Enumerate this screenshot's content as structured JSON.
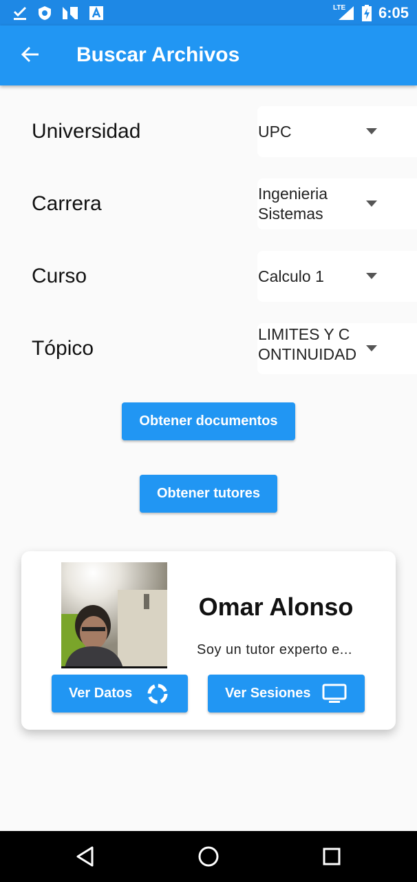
{
  "status_bar": {
    "time": "6:05",
    "network_label": "LTE",
    "icons": [
      "download-done-icon",
      "shield-icon",
      "n-app-icon",
      "a-app-icon",
      "signal-icon",
      "battery-charging-icon"
    ]
  },
  "app_bar": {
    "title": "Buscar Archivos",
    "back_icon": "arrow-back-icon"
  },
  "filters": [
    {
      "label": "Universidad",
      "value": "UPC"
    },
    {
      "label": "Carrera",
      "value": "Ingenieria Sistemas"
    },
    {
      "label": "Curso",
      "value": "Calculo 1"
    },
    {
      "label": "Tópico",
      "value": "LIMITES Y CONTINUIDAD"
    }
  ],
  "actions": {
    "get_documents": "Obtener documentos",
    "get_tutors": "Obtener tutores"
  },
  "tutor_card": {
    "name": "Omar Alonso",
    "description": "Soy un tutor experto e...",
    "view_data_label": "Ver Datos",
    "view_data_icon": "donut-loading-icon",
    "view_sessions_label": "Ver Sesiones",
    "view_sessions_icon": "monitor-icon"
  },
  "nav_bar": {
    "icons": [
      "back-triangle-icon",
      "home-circle-icon",
      "recents-square-icon"
    ]
  },
  "colors": {
    "primary": "#2196f3",
    "status_bar": "#1e88e5",
    "background": "#fafafa"
  }
}
